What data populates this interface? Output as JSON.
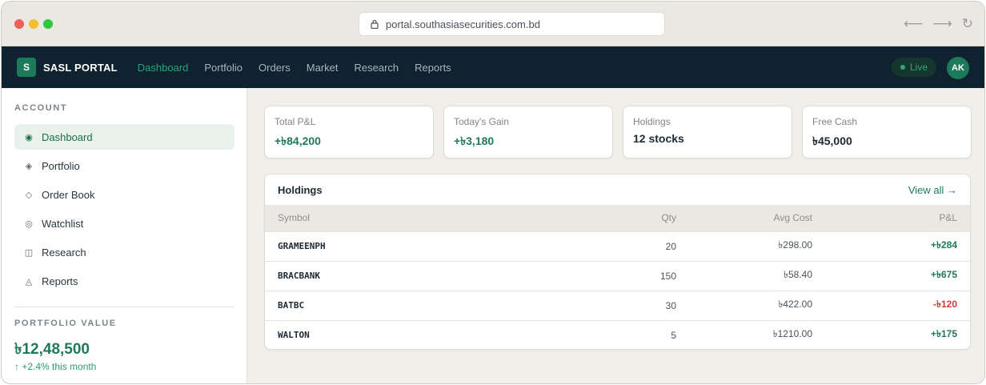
{
  "browser": {
    "url": "portal.southasiasecurities.com.bd",
    "back_glyph": "⟵",
    "forward_glyph": "⟶",
    "reload_glyph": "↻"
  },
  "topnav": {
    "logo_letter": "S",
    "brand": "SASL PORTAL",
    "links": [
      "Dashboard",
      "Portfolio",
      "Orders",
      "Market",
      "Research",
      "Reports"
    ],
    "active_link": "Dashboard",
    "live_label": "Live",
    "avatar_initials": "AK"
  },
  "sidebar": {
    "account_heading": "ACCOUNT",
    "items": [
      {
        "label": "Dashboard",
        "icon": "radio-dot-icon",
        "glyph": "◉"
      },
      {
        "label": "Portfolio",
        "icon": "diamond-dot-icon",
        "glyph": "◈"
      },
      {
        "label": "Order Book",
        "icon": "diamond-outline-icon",
        "glyph": "◇"
      },
      {
        "label": "Watchlist",
        "icon": "target-icon",
        "glyph": "◎"
      },
      {
        "label": "Research",
        "icon": "columns-icon",
        "glyph": "◫"
      },
      {
        "label": "Reports",
        "icon": "triangle-icon",
        "glyph": "◬"
      }
    ],
    "portfolio_heading": "PORTFOLIO VALUE",
    "portfolio_value": "৳12,48,500",
    "portfolio_change": "↑ +2.4% this month"
  },
  "cards": [
    {
      "label": "Total P&L",
      "value": "+৳84,200",
      "positive": true
    },
    {
      "label": "Today's Gain",
      "value": "+৳3,180",
      "positive": true
    },
    {
      "label": "Holdings",
      "value": "12 stocks",
      "positive": false
    },
    {
      "label": "Free Cash",
      "value": "৳45,000",
      "positive": false
    }
  ],
  "holdings": {
    "title": "Holdings",
    "view_all": "View all →",
    "columns": [
      "Symbol",
      "Qty",
      "Avg Cost",
      "P&L"
    ],
    "rows": [
      {
        "symbol": "GRAMEENPH",
        "qty": "20",
        "avg_cost": "৳298.00",
        "pnl": "+৳284",
        "direction": "up"
      },
      {
        "symbol": "BRACBANK",
        "qty": "150",
        "avg_cost": "৳58.40",
        "pnl": "+৳675",
        "direction": "up"
      },
      {
        "symbol": "BATBC",
        "qty": "30",
        "avg_cost": "৳422.00",
        "pnl": "-৳120",
        "direction": "down"
      },
      {
        "symbol": "WALTON",
        "qty": "5",
        "avg_cost": "৳1210.00",
        "pnl": "+৳175",
        "direction": "up"
      }
    ]
  },
  "colors": {
    "accent": "#1e7a58",
    "nav_bg": "#0f2230",
    "negative": "#d23a34"
  }
}
